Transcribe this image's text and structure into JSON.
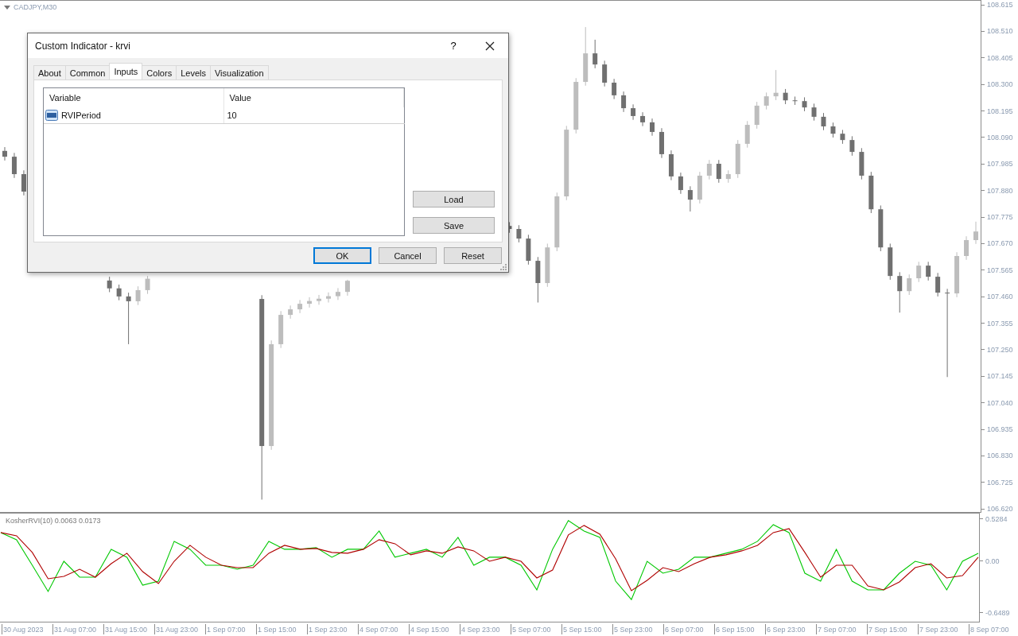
{
  "chart": {
    "symbol": "CADJPY,M30",
    "price_chart": {
      "chart_data": {
        "type": "candlestick",
        "ylim": [
          106.611,
          108.634
        ],
        "yticks": [
          {
            "value": 108.615,
            "label": "108.615"
          },
          {
            "value": 108.51,
            "label": "108.510"
          },
          {
            "value": 108.405,
            "label": "108.405"
          },
          {
            "value": 108.3,
            "label": "108.300"
          },
          {
            "value": 108.195,
            "label": "108.195"
          },
          {
            "value": 108.09,
            "label": "108.090"
          },
          {
            "value": 107.985,
            "label": "107.985"
          },
          {
            "value": 107.88,
            "label": "107.880"
          },
          {
            "value": 107.775,
            "label": "107.775"
          },
          {
            "value": 107.67,
            "label": "107.670"
          },
          {
            "value": 107.565,
            "label": "107.565"
          },
          {
            "value": 107.46,
            "label": "107.460"
          },
          {
            "value": 107.355,
            "label": "107.355"
          },
          {
            "value": 107.25,
            "label": "107.250"
          },
          {
            "value": 107.145,
            "label": "107.145"
          },
          {
            "value": 107.04,
            "label": "107.040"
          },
          {
            "value": 106.935,
            "label": "106.935"
          },
          {
            "value": 106.83,
            "label": "106.830"
          },
          {
            "value": 106.725,
            "label": "106.725"
          },
          {
            "value": 106.62,
            "label": "106.620"
          }
        ],
        "categories": [
          null,
          null,
          null,
          null,
          null,
          null,
          null,
          null,
          null,
          null,
          null,
          null,
          null,
          null,
          null,
          null,
          null,
          null,
          null,
          null,
          null,
          null,
          null,
          null,
          null,
          null,
          null,
          null,
          null,
          null,
          null,
          null,
          null,
          null,
          null,
          null,
          null,
          null,
          null,
          null,
          null,
          null,
          null,
          null,
          null,
          null,
          null,
          null,
          null,
          null,
          null,
          null,
          null,
          null,
          null,
          null,
          null,
          null,
          null,
          null,
          null,
          null,
          null,
          null,
          null,
          null,
          null,
          null,
          null,
          null,
          null,
          null,
          null,
          null,
          null,
          null,
          null,
          null,
          null,
          null,
          null,
          null,
          null,
          null,
          null,
          null,
          null,
          null,
          null,
          null,
          null,
          null,
          null,
          null,
          null,
          null,
          null,
          null,
          null,
          null,
          null,
          null,
          null
        ],
        "ohlc": [
          [
            108.04,
            108.055,
            108.002,
            108.017
          ],
          [
            108.017,
            108.032,
            107.933,
            107.948
          ],
          [
            107.948,
            107.963,
            107.864,
            107.879
          ],
          null,
          null,
          null,
          null,
          null,
          null,
          null,
          null,
          [
            107.527,
            107.542,
            107.481,
            107.496
          ],
          [
            107.496,
            107.511,
            107.449,
            107.464
          ],
          [
            107.464,
            107.479,
            107.275,
            107.445
          ],
          [
            107.445,
            107.504,
            107.43,
            107.489
          ],
          [
            107.489,
            107.545,
            107.474,
            107.534
          ],
          null,
          null,
          null,
          null,
          null,
          null,
          null,
          null,
          null,
          null,
          null,
          [
            107.454,
            107.469,
            106.66,
            106.872
          ],
          [
            106.872,
            107.29,
            106.857,
            107.275
          ],
          [
            107.275,
            107.406,
            107.26,
            107.391
          ],
          [
            107.391,
            107.428,
            107.376,
            107.413
          ],
          [
            107.413,
            107.45,
            107.398,
            107.435
          ],
          [
            107.435,
            107.461,
            107.42,
            107.446
          ],
          [
            107.446,
            107.47,
            107.431,
            107.455
          ],
          [
            107.455,
            107.48,
            107.44,
            107.465
          ],
          [
            107.465,
            107.497,
            107.45,
            107.482
          ],
          [
            107.482,
            107.53,
            107.467,
            107.526
          ],
          null,
          null,
          null,
          null,
          null,
          null,
          null,
          null,
          null,
          null,
          null,
          null,
          null,
          null,
          null,
          null,
          [
            107.743,
            107.758,
            107.716,
            107.731
          ],
          [
            107.731,
            107.746,
            107.678,
            107.693
          ],
          [
            107.693,
            107.708,
            107.59,
            107.605
          ],
          [
            107.605,
            107.62,
            107.44,
            107.517
          ],
          [
            107.517,
            107.673,
            107.502,
            107.658
          ],
          [
            107.658,
            107.875,
            107.643,
            107.86
          ],
          [
            107.86,
            108.139,
            107.845,
            108.124
          ],
          [
            108.124,
            108.328,
            108.109,
            108.313
          ],
          [
            108.313,
            108.53,
            108.298,
            108.426
          ],
          [
            108.426,
            108.48,
            108.367,
            108.382
          ],
          [
            108.382,
            108.397,
            108.295,
            108.31
          ],
          [
            108.31,
            108.325,
            108.245,
            108.26
          ],
          [
            108.26,
            108.275,
            108.194,
            108.209
          ],
          [
            108.209,
            108.224,
            108.163,
            108.178
          ],
          [
            108.178,
            108.193,
            108.138,
            108.153
          ],
          [
            108.153,
            108.168,
            108.1,
            108.115
          ],
          [
            108.115,
            108.13,
            108.012,
            108.027
          ],
          [
            108.027,
            108.042,
            107.924,
            107.939
          ],
          [
            107.939,
            107.954,
            107.87,
            107.885
          ],
          [
            107.885,
            107.9,
            107.8,
            107.847
          ],
          [
            107.847,
            107.957,
            107.832,
            107.942
          ],
          [
            107.942,
            108.004,
            107.927,
            107.989
          ],
          [
            107.989,
            108.004,
            107.914,
            107.929
          ],
          [
            107.929,
            107.963,
            107.914,
            107.948
          ],
          [
            107.948,
            108.083,
            107.933,
            108.068
          ],
          [
            108.068,
            108.158,
            108.053,
            108.143
          ],
          [
            108.143,
            108.234,
            108.128,
            108.219
          ],
          [
            108.219,
            108.271,
            108.204,
            108.256
          ],
          [
            108.256,
            108.36,
            108.241,
            108.27
          ],
          [
            108.27,
            108.285,
            108.225,
            108.24
          ],
          [
            108.24,
            108.255,
            108.222,
            108.237
          ],
          [
            108.237,
            108.252,
            108.197,
            108.212
          ],
          [
            108.212,
            108.227,
            108.16,
            108.175
          ],
          [
            108.175,
            108.19,
            108.122,
            108.137
          ],
          [
            108.137,
            108.152,
            108.093,
            108.108
          ],
          [
            108.108,
            108.123,
            108.068,
            108.083
          ],
          [
            108.083,
            108.098,
            108.021,
            108.036
          ],
          [
            108.036,
            108.051,
            107.927,
            107.942
          ],
          [
            107.942,
            107.957,
            107.794,
            107.809
          ],
          [
            107.809,
            107.824,
            107.643,
            107.658
          ],
          [
            107.658,
            107.673,
            107.53,
            107.545
          ],
          [
            107.545,
            107.56,
            107.4,
            107.485
          ],
          [
            107.485,
            107.551,
            107.47,
            107.536
          ],
          [
            107.536,
            107.601,
            107.521,
            107.586
          ],
          [
            107.586,
            107.601,
            107.527,
            107.542
          ],
          [
            107.542,
            107.557,
            107.464,
            107.479
          ],
          [
            107.479,
            107.494,
            107.145,
            107.476
          ],
          [
            107.476,
            107.639,
            107.461,
            107.624
          ],
          [
            107.624,
            107.702,
            107.609,
            107.687
          ],
          [
            107.687,
            107.76,
            107.672,
            107.721
          ]
        ]
      }
    },
    "indicator": {
      "chart_data": {
        "type": "line",
        "title": "KosherRVI(10) 0.0063 0.0173",
        "ylim": [
          -0.7387,
          0.6082
        ],
        "categories": [
          null,
          null,
          null,
          null,
          null,
          null,
          null,
          null,
          null,
          null,
          null,
          null,
          null,
          null,
          null,
          null,
          null,
          null,
          null,
          null,
          null,
          null,
          null,
          null,
          null,
          null,
          null,
          null,
          null,
          null,
          null,
          null,
          null,
          null,
          null,
          null,
          null,
          null,
          null,
          null,
          null,
          null,
          null,
          null,
          null,
          null,
          null,
          null,
          null,
          null,
          null,
          null,
          null,
          null,
          null,
          null,
          null,
          null,
          null,
          null,
          null,
          null,
          null
        ],
        "yticks": [
          {
            "value": 0.5284,
            "label": "0.5284"
          },
          {
            "value": 0,
            "label": "0.00"
          },
          {
            "value": -0.6489,
            "label": "-0.6489"
          }
        ],
        "series": [
          {
            "color": "#00c800",
            "values": [
              0.37,
              0.28,
              -0.04,
              -0.37,
              0.01,
              -0.19,
              -0.19,
              0.16,
              0.06,
              -0.29,
              -0.24,
              0.26,
              0.16,
              -0.04,
              -0.04,
              -0.09,
              -0.04,
              0.26,
              0.16,
              0.16,
              0.18,
              0.06,
              0.16,
              0.16,
              0.39,
              0.06,
              0.11,
              0.16,
              0.06,
              0.31,
              -0.04,
              0.06,
              0.06,
              -0.04,
              -0.35,
              0.16,
              0.52,
              0.39,
              0.31,
              -0.24,
              -0.47,
              0.01,
              -0.14,
              -0.09,
              0.06,
              0.06,
              0.11,
              0.16,
              0.26,
              0.47,
              0.37,
              -0.14,
              -0.24,
              0.16,
              -0.24,
              -0.35,
              -0.35,
              -0.14,
              0.01,
              -0.04,
              -0.35,
              0.01,
              0.11
            ]
          },
          {
            "color": "#b00000",
            "values": [
              0.37,
              0.33,
              0.12,
              -0.21,
              -0.18,
              -0.09,
              -0.19,
              -0.02,
              0.11,
              -0.12,
              -0.27,
              0.01,
              0.21,
              0.06,
              -0.04,
              -0.07,
              -0.07,
              0.11,
              0.21,
              0.16,
              0.17,
              0.12,
              0.11,
              0.16,
              0.28,
              0.23,
              0.09,
              0.14,
              0.11,
              0.19,
              0.14,
              0.01,
              0.06,
              0.01,
              -0.2,
              -0.1,
              0.34,
              0.46,
              0.35,
              0.04,
              -0.36,
              -0.23,
              -0.07,
              -0.12,
              -0.02,
              0.06,
              0.09,
              0.14,
              0.21,
              0.37,
              0.42,
              0.12,
              -0.19,
              -0.04,
              -0.04,
              -0.3,
              -0.35,
              -0.25,
              -0.07,
              -0.02,
              -0.2,
              -0.17,
              0.06
            ]
          }
        ]
      }
    },
    "time_axis": [
      "30 Aug 2023",
      "31 Aug 07:00",
      "31 Aug 15:00",
      "31 Aug 23:00",
      "1 Sep 07:00",
      "1 Sep 15:00",
      "1 Sep 23:00",
      "4 Sep 07:00",
      "4 Sep 15:00",
      "4 Sep 23:00",
      "5 Sep 07:00",
      "5 Sep 15:00",
      "5 Sep 23:00",
      "6 Sep 07:00",
      "6 Sep 15:00",
      "6 Sep 23:00",
      "7 Sep 07:00",
      "7 Sep 15:00",
      "7 Sep 23:00",
      "8 Sep 07:00"
    ]
  },
  "dialog": {
    "title": "Custom Indicator - krvi",
    "help": "?",
    "tabs": [
      {
        "label": "About",
        "selected": false
      },
      {
        "label": "Common",
        "selected": false
      },
      {
        "label": "Inputs",
        "selected": true
      },
      {
        "label": "Colors",
        "selected": false
      },
      {
        "label": "Levels",
        "selected": false
      },
      {
        "label": "Visualization",
        "selected": false
      }
    ],
    "table": {
      "columns": [
        "Variable",
        "Value"
      ],
      "rows": [
        {
          "variable": "RVIPeriod",
          "value": "10"
        }
      ]
    },
    "side_buttons": [
      "Load",
      "Save"
    ],
    "buttons": [
      {
        "label": "OK",
        "default": true
      },
      {
        "label": "Cancel",
        "default": false
      },
      {
        "label": "Reset",
        "default": false
      }
    ]
  }
}
